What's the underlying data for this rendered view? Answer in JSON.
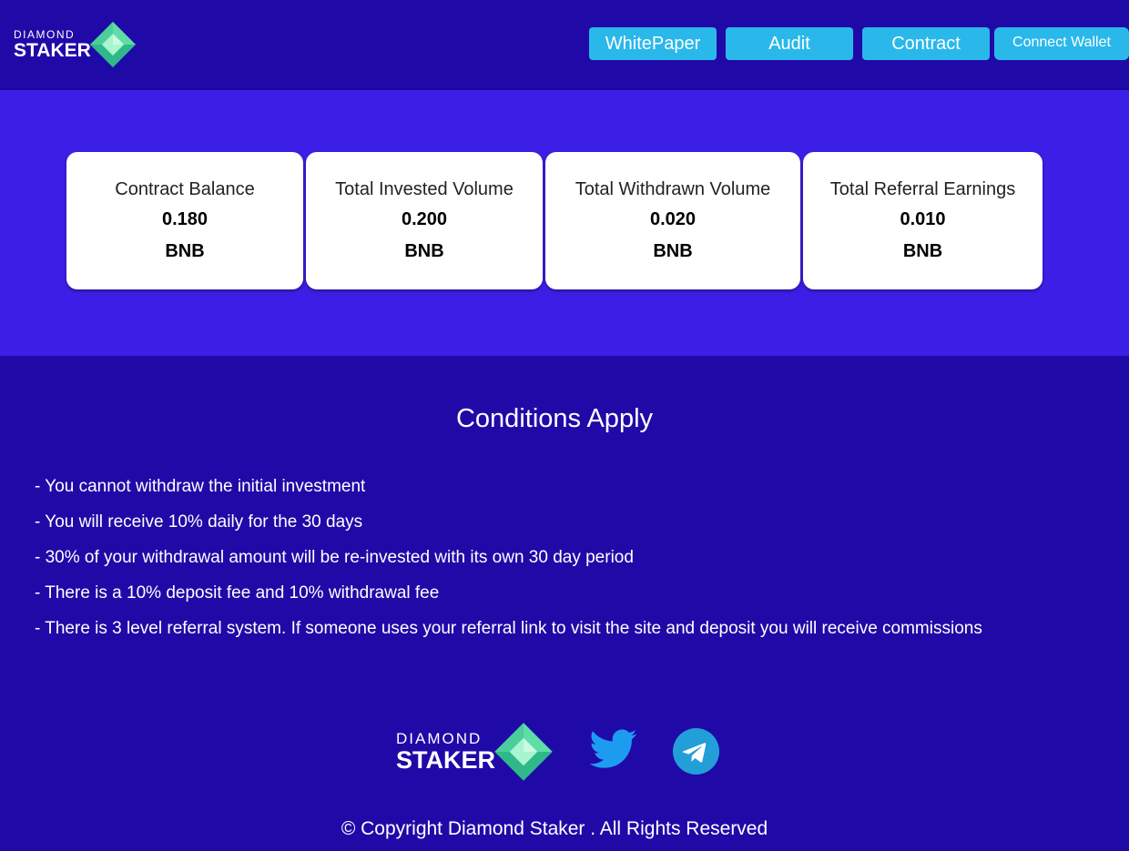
{
  "brand": {
    "line1": "DIAMOND",
    "line2": "STAKER"
  },
  "nav": {
    "whitepaper": "WhitePaper",
    "audit": "Audit",
    "contract": "Contract",
    "connect_wallet": "Connect Wallet"
  },
  "stats": [
    {
      "title": "Contract Balance",
      "value": "0.180",
      "unit": "BNB"
    },
    {
      "title": "Total Invested Volume",
      "value": "0.200",
      "unit": "BNB"
    },
    {
      "title": "Total Withdrawn Volume",
      "value": "0.020",
      "unit": "BNB"
    },
    {
      "title": "Total Referral Earnings",
      "value": "0.010",
      "unit": "BNB"
    }
  ],
  "conditions": {
    "title": "Conditions Apply",
    "items": [
      "- You cannot withdraw the initial investment",
      "- You will receive 10% daily for the 30 days",
      "- 30% of your withdrawal amount will be re-invested with its own 30 day period",
      "- There is a 10% deposit fee and 10% withdrawal fee",
      "- There is 3 level referral system. If someone uses your referral link to visit the site and deposit you will receive commissions"
    ]
  },
  "footer": {
    "copyright": "© Copyright Diamond Staker . All Rights Reserved",
    "social": [
      "twitter-icon",
      "telegram-icon"
    ]
  },
  "colors": {
    "background": "#1f0aa8",
    "stats_band": "#3b1fe6",
    "button": "#2ab8ea",
    "gem_light": "#8ef0c0",
    "gem_dark": "#2fb98a",
    "twitter": "#1d9bf0",
    "telegram": "#229ed9"
  }
}
